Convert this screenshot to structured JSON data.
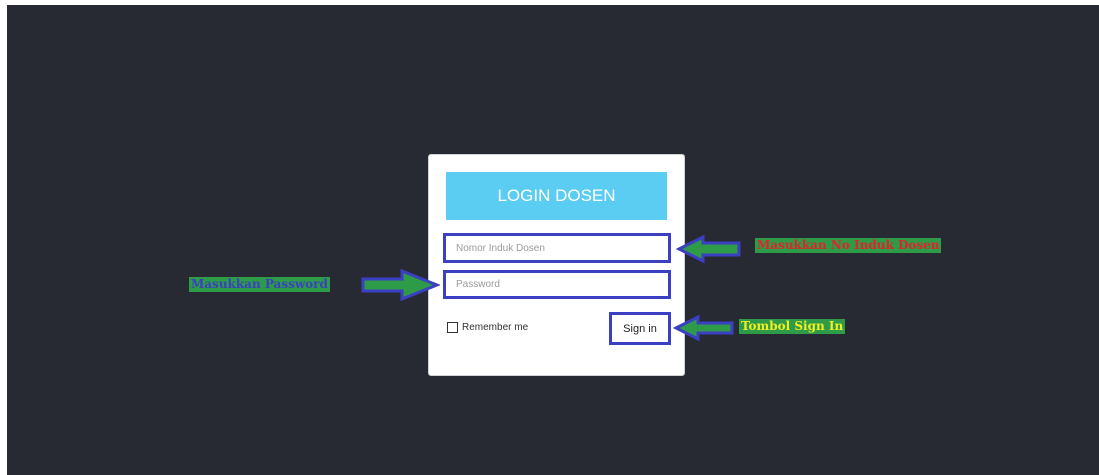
{
  "login": {
    "title": "LOGIN DOSEN",
    "nidn_placeholder": "Nomor Induk Dosen",
    "password_placeholder": "Password",
    "remember_label": "Remember me",
    "signin_label": "Sign in"
  },
  "annotations": {
    "nidn_note": "Masukkan No Induk Dosen",
    "password_note": "Masukkan Password",
    "signin_note": "Tombol Sign In"
  },
  "colors": {
    "background": "#272a33",
    "header": "#5ccdf2",
    "frame": "#3b3fc1",
    "arrow_fill": "#2e9b49",
    "note_red": "#e0242a",
    "note_blue": "#3b3fc1",
    "note_yellow": "#f2ee1f"
  }
}
